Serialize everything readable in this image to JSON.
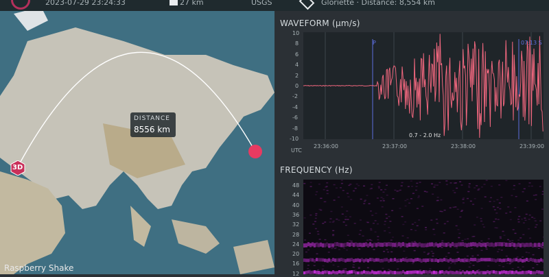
{
  "header": {
    "datetime": "2023-07-29 23:24:33",
    "depth": "27 km",
    "source": "USGS",
    "station": "Gloriette · Distance: 8,554 km"
  },
  "map": {
    "distance_label": "DISTANCE",
    "distance_value": "8556 km",
    "badge_3d": "3D",
    "bottom_brand": "Raspberry Shake",
    "colors": {
      "water": "#3f6f82",
      "land": "#c6c3b8",
      "path": "#ffffff",
      "quake": "#e83a61",
      "badge": "#c9305a"
    }
  },
  "waveform": {
    "title": "WAVEFORM (μm/s)",
    "y_ticks": [
      "10",
      "8",
      "6",
      "4",
      "2",
      "0",
      "-2",
      "-4",
      "-6",
      "-8",
      "-10"
    ],
    "x_ticks": [
      "23:36:00",
      "23:37:00",
      "23:38:00",
      "23:39:00"
    ],
    "tz": "UTC",
    "filter": "0.7 - 2.0 Hz",
    "p_marker": "P",
    "t_marker": "07:13 S",
    "color": "#f0677e"
  },
  "frequency": {
    "title": "FREQUENCY (Hz)",
    "y_ticks": [
      "48",
      "44",
      "40",
      "36",
      "32",
      "28",
      "24",
      "20",
      "16",
      "12"
    ],
    "colors": {
      "background": "#0d0a12",
      "band": "#c32fd6"
    }
  }
}
